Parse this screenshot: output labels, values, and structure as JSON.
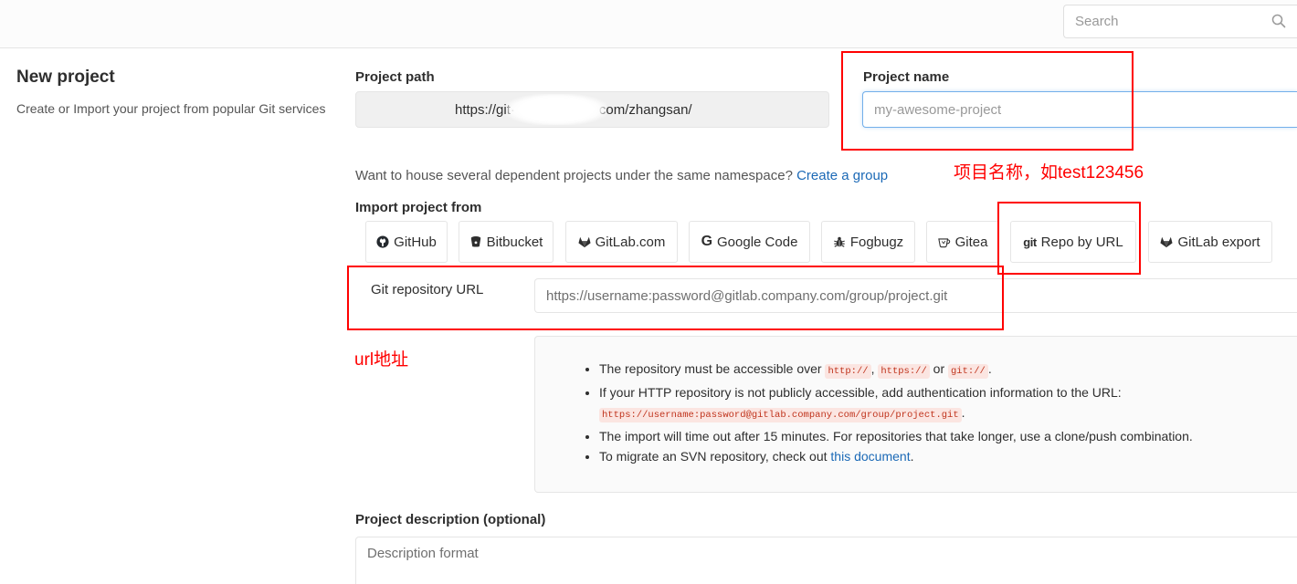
{
  "header": {
    "search_placeholder": "Search",
    "search_icon": "search-icon"
  },
  "sidebar": {
    "title": "New project",
    "description": "Create or Import your project from popular Git services"
  },
  "form": {
    "project_path": {
      "label": "Project path",
      "value_prefix": "https://git·",
      "value_suffix": "com/zhangsan/"
    },
    "project_name": {
      "label": "Project name",
      "placeholder": "my-awesome-project"
    },
    "group_hint": {
      "text": "Want to house several dependent projects under the same namespace? ",
      "link": "Create a group"
    },
    "import": {
      "label": "Import project from",
      "selected": "Repo by URL",
      "sources": [
        {
          "label": "GitHub",
          "icon": "github-icon"
        },
        {
          "label": "Bitbucket",
          "icon": "bitbucket-icon"
        },
        {
          "label": "GitLab.com",
          "icon": "gitlab-icon"
        },
        {
          "label": "Google Code",
          "icon": "google-icon",
          "icon_glyph": "G"
        },
        {
          "label": "Fogbugz",
          "icon": "fogbugz-icon"
        },
        {
          "label": "Gitea",
          "icon": "gitea-icon"
        },
        {
          "label": "Repo by URL",
          "icon": "git-icon",
          "icon_glyph": "git"
        },
        {
          "label": "GitLab export",
          "icon": "gitlab-icon"
        }
      ]
    },
    "git_url": {
      "label": "Git repository URL",
      "placeholder": "https://username:password@gitlab.company.com/group/project.git"
    },
    "info": {
      "bullet_1": {
        "text_1": "The repository must be accessible over ",
        "code_1": "http://",
        "text_2": ", ",
        "code_2": "https://",
        "text_3": " or ",
        "code_3": "git://",
        "text_4": "."
      },
      "bullet_2": {
        "text_1": "If your HTTP repository is not publicly accessible, add authentication information to the URL: ",
        "code_1": "https://username:password@gitlab.company.com/group/project.git",
        "text_2": "."
      },
      "bullet_3": {
        "text": "The import will time out after 15 minutes. For repositories that take longer, use a clone/push combination."
      },
      "bullet_4": {
        "text_1": "To migrate an SVN repository, check out ",
        "link": "this document",
        "text_2": "."
      }
    },
    "description": {
      "label": "Project description (optional)",
      "placeholder": "Description format"
    }
  },
  "annotations": {
    "project_name_note": "项目名称，如test123456",
    "url_note": "url地址"
  },
  "colors": {
    "link": "#1b69b6",
    "annotation_red": "#ff0000",
    "focus_border": "#73afea",
    "code_text": "#c0341d",
    "code_background": "#fbe5e1"
  }
}
